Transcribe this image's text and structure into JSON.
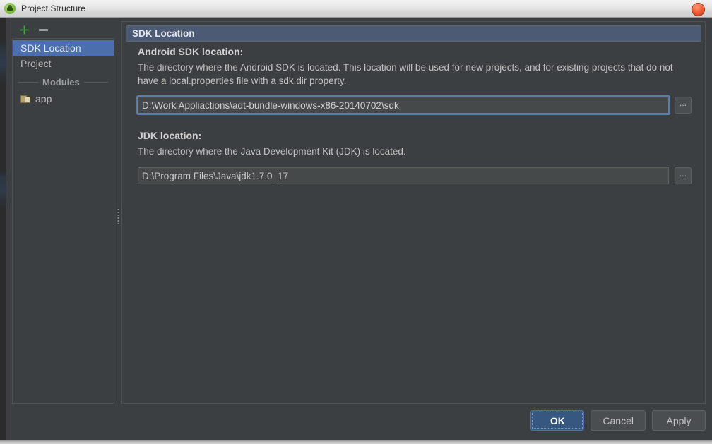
{
  "window": {
    "title": "Project Structure",
    "app_icon": "android-robot-icon",
    "close_icon": "close-icon"
  },
  "sidebar": {
    "toolbar": {
      "add_label": "+",
      "add_icon": "plus-icon",
      "remove_label": "−",
      "remove_icon": "minus-icon"
    },
    "items": [
      {
        "label": "SDK Location",
        "selected": true
      },
      {
        "label": "Project",
        "selected": false
      }
    ],
    "group_label": "Modules",
    "modules": [
      {
        "label": "app",
        "icon": "module-icon"
      }
    ]
  },
  "main": {
    "header_title": "SDK Location",
    "sections": [
      {
        "title": "Android SDK location:",
        "description": "The directory where the Android SDK is located. This location will be used for new projects, and for existing projects that do not have a local.properties file with a sdk.dir property.",
        "field_value": "D:\\Work Appliactions\\adt-bundle-windows-x86-20140702\\sdk",
        "field_placeholder": "",
        "browse_label": "...",
        "focused": true
      },
      {
        "title": "JDK location:",
        "description": "The directory where the Java Development Kit (JDK) is located.",
        "field_value": "D:\\Program Files\\Java\\jdk1.7.0_17",
        "field_placeholder": "",
        "browse_label": "...",
        "focused": false
      }
    ]
  },
  "footer": {
    "ok_label": "OK",
    "cancel_label": "Cancel",
    "apply_label": "Apply"
  },
  "colors": {
    "background": "#3c3f41",
    "selection_blue": "#4b6eaf",
    "header_blue": "#4c5a74",
    "default_button_blue": "#365880",
    "add_green": "#4f9f4f",
    "close_red": "#f2603a"
  }
}
